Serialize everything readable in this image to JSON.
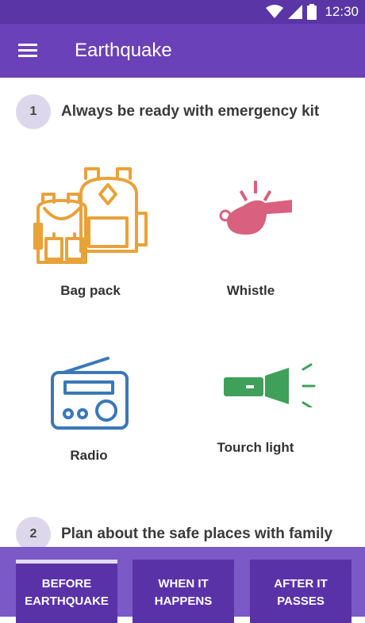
{
  "status_bar": {
    "time": "12:30",
    "icons": [
      "wifi-icon",
      "signal-icon",
      "battery-icon"
    ]
  },
  "app_bar": {
    "title": "Earthquake",
    "menu_icon": "hamburger-menu-icon"
  },
  "sections": [
    {
      "number": "1",
      "title": "Always be ready with emergency kit",
      "items": [
        {
          "label": "Bag pack",
          "icon": "backpack-icon",
          "color": "#e8a23a"
        },
        {
          "label": "Whistle",
          "icon": "whistle-icon",
          "color": "#d9607e"
        },
        {
          "label": "Radio",
          "icon": "radio-icon",
          "color": "#3a78b8"
        },
        {
          "label": "Tourch light",
          "icon": "flashlight-icon",
          "color": "#3fa05a"
        }
      ]
    },
    {
      "number": "2",
      "title": "Plan about the safe places with family"
    }
  ],
  "bottom_nav": {
    "tabs": [
      {
        "label_line1": "BEFORE",
        "label_line2": "EARTHQUAKE",
        "active": true
      },
      {
        "label_line1": "WHEN IT",
        "label_line2": "HAPPENS",
        "active": false
      },
      {
        "label_line1": "AFTER IT",
        "label_line2": "PASSES",
        "active": false
      }
    ]
  },
  "colors": {
    "status_bar": "#5a35a6",
    "app_bar": "#6a41b8",
    "bottom_nav": "#7b59c6",
    "tab_background": "#5a32a8",
    "step_circle": "#ddd7ec"
  }
}
